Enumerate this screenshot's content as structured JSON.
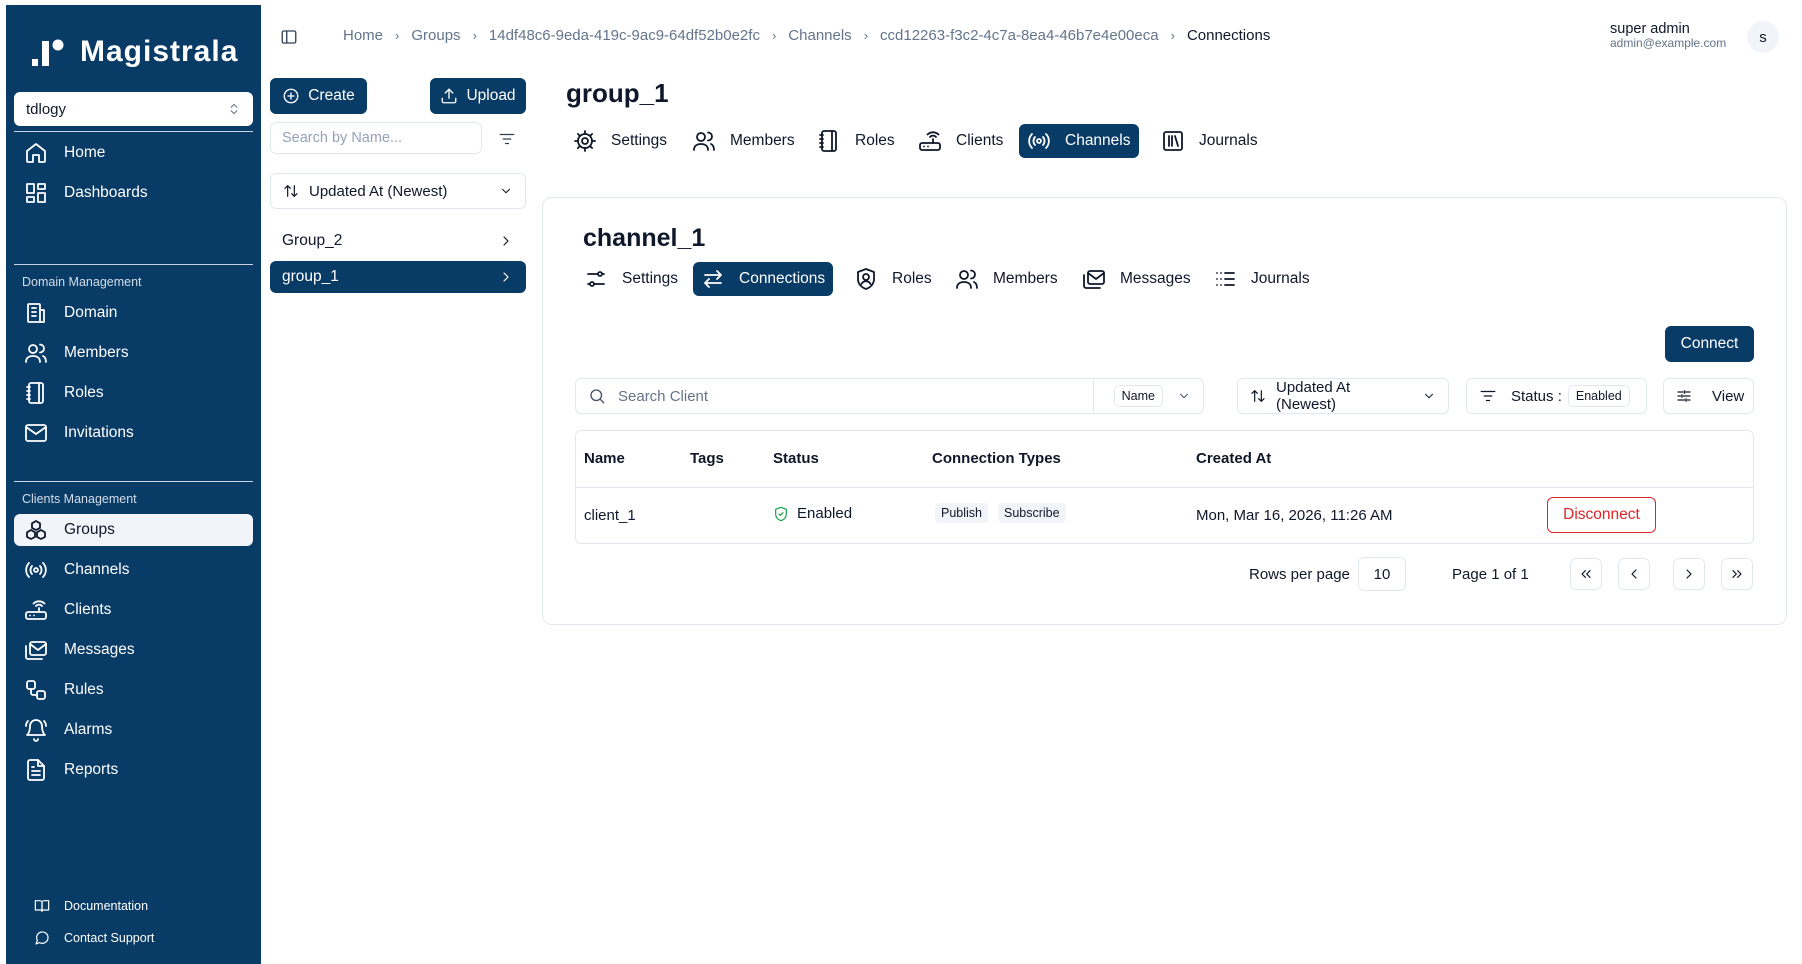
{
  "app": {
    "name": "Magistrala"
  },
  "domain_select": {
    "value": "tdlogy"
  },
  "sidebar": {
    "top_items": [
      {
        "label": "Home",
        "icon": "home-icon"
      },
      {
        "label": "Dashboards",
        "icon": "dashboard-icon"
      }
    ],
    "domain_section": "Domain Management",
    "domain_items": [
      {
        "label": "Domain",
        "icon": "building-icon"
      },
      {
        "label": "Members",
        "icon": "users-icon"
      },
      {
        "label": "Roles",
        "icon": "notebook-icon"
      },
      {
        "label": "Invitations",
        "icon": "mail-icon"
      }
    ],
    "clients_section": "Clients Management",
    "clients_items": [
      {
        "label": "Groups",
        "icon": "boxes-icon",
        "active": true
      },
      {
        "label": "Channels",
        "icon": "radio-icon"
      },
      {
        "label": "Clients",
        "icon": "router-icon"
      },
      {
        "label": "Messages",
        "icon": "mails-icon"
      },
      {
        "label": "Rules",
        "icon": "workflow-icon"
      },
      {
        "label": "Alarms",
        "icon": "bell-ring-icon"
      },
      {
        "label": "Reports",
        "icon": "file-text-icon"
      }
    ],
    "footer": [
      {
        "label": "Documentation",
        "icon": "book-icon"
      },
      {
        "label": "Contact Support",
        "icon": "message-circle-icon"
      }
    ]
  },
  "breadcrumb": [
    "Home",
    "Groups",
    "14df48c6-9eda-419c-9ac9-64df52b0e2fc",
    "Channels",
    "ccd12263-f3c2-4c7a-8ea4-46b7e4e00eca",
    "Connections"
  ],
  "user": {
    "name": "super admin",
    "email": "admin@example.com",
    "initial": "s"
  },
  "left_panel": {
    "create_label": "Create",
    "upload_label": "Upload",
    "search_placeholder": "Search by Name...",
    "sort_label": "Updated At (Newest)",
    "groups": [
      {
        "name": "Group_2",
        "active": false
      },
      {
        "name": "group_1",
        "active": true
      }
    ]
  },
  "group": {
    "title": "group_1",
    "tabs": [
      {
        "label": "Settings",
        "icon": "settings-icon"
      },
      {
        "label": "Members",
        "icon": "users-icon"
      },
      {
        "label": "Roles",
        "icon": "notebook-icon"
      },
      {
        "label": "Clients",
        "icon": "router-icon"
      },
      {
        "label": "Channels",
        "icon": "radio-icon",
        "active": true
      },
      {
        "label": "Journals",
        "icon": "library-icon"
      }
    ]
  },
  "channel": {
    "title": "channel_1",
    "tabs": [
      {
        "label": "Settings",
        "icon": "sliders-icon"
      },
      {
        "label": "Connections",
        "icon": "arrow-right-left-icon",
        "active": true
      },
      {
        "label": "Roles",
        "icon": "shield-user-icon"
      },
      {
        "label": "Members",
        "icon": "users-icon"
      },
      {
        "label": "Messages",
        "icon": "mails-icon"
      },
      {
        "label": "Journals",
        "icon": "list-icon"
      }
    ]
  },
  "connections": {
    "connect_label": "Connect",
    "search_placeholder": "Search Client",
    "search_field": "Name",
    "sort_label": "Updated At (Newest)",
    "status_label": "Status :",
    "status_value": "Enabled",
    "view_label": "View",
    "columns": [
      "Name",
      "Tags",
      "Status",
      "Connection Types",
      "Created At"
    ],
    "rows": [
      {
        "name": "client_1",
        "tags": "",
        "status": "Enabled",
        "types": [
          "Publish",
          "Subscribe"
        ],
        "created_at": "Mon, Mar 16, 2026, 11:26 AM",
        "action": "Disconnect"
      }
    ],
    "pagination": {
      "rows_label": "Rows per page",
      "rows_value": "10",
      "page_label": "Page 1 of 1"
    }
  },
  "colors": {
    "brand": "#083b66",
    "danger": "#dc2626",
    "success": "#16a34a"
  }
}
